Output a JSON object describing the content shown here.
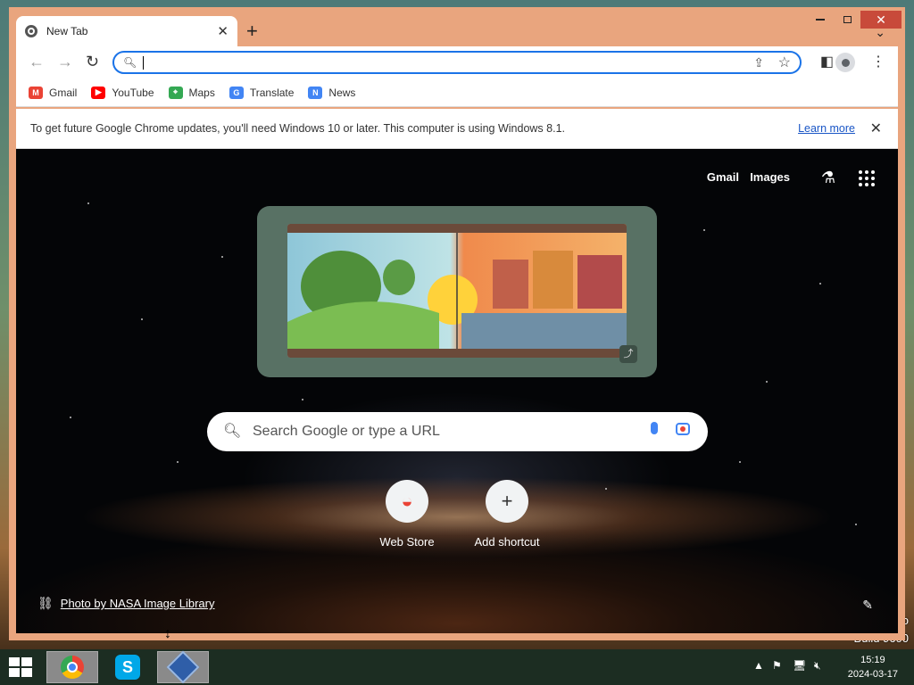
{
  "desktop": {
    "watermark_line1": "o",
    "watermark_line2": "Build 9600"
  },
  "window": {
    "caption": {
      "minimize": "—",
      "maximize": "☐",
      "close": "✕"
    }
  },
  "tabs": [
    {
      "title": "New Tab",
      "close": "✕"
    }
  ],
  "tabstrip": {
    "new_tab": "+",
    "tab_search": "⌄"
  },
  "toolbar": {
    "back": "←",
    "forward": "→",
    "reload": "↻",
    "omnibox_value": "",
    "search_glyph": "🔍︎",
    "share_glyph": "⇪",
    "bookmark_glyph": "☆",
    "side_panel_glyph": "◧",
    "menu_glyph": "⋮"
  },
  "bookmarks": [
    {
      "label": "Gmail",
      "icon": "gmail-icon",
      "color": "#ea4335",
      "glyph": "M"
    },
    {
      "label": "YouTube",
      "icon": "youtube-icon",
      "color": "#ff0000",
      "glyph": "▶"
    },
    {
      "label": "Maps",
      "icon": "maps-icon",
      "color": "#34a853",
      "glyph": "⌖"
    },
    {
      "label": "Translate",
      "icon": "translate-icon",
      "color": "#4285f4",
      "glyph": "G"
    },
    {
      "label": "News",
      "icon": "news-icon",
      "color": "#4285f4",
      "glyph": "N"
    }
  ],
  "infobar": {
    "message": "To get future Google Chrome updates, you'll need Windows 10 or later. This computer is using Windows 8.1.",
    "link": "Learn more",
    "close": "✕"
  },
  "ntp": {
    "header_links": [
      "Gmail",
      "Images"
    ],
    "labs_glyph": "⚗",
    "search_placeholder": "Search Google or type a URL",
    "search_glyph": "🔍︎",
    "doodle_share_glyph": "⤴",
    "shortcuts": [
      {
        "label": "Web Store",
        "glyph": "◒"
      },
      {
        "label": "Add shortcut",
        "glyph": "+"
      }
    ],
    "photo_credit": "Photo by NASA Image Library",
    "link_glyph": "⛓",
    "edit_glyph": "✎"
  },
  "taskbar": {
    "tray_glyphs": [
      "▲",
      "⚑",
      "🖥︎",
      "🔇︎"
    ],
    "time": "15:19",
    "date": "2024-03-17"
  },
  "colors": {
    "window_frame": "#e9a57e",
    "accent": "#1a73e8",
    "link": "#1a56c6",
    "taskbar": "#1c2d22"
  }
}
